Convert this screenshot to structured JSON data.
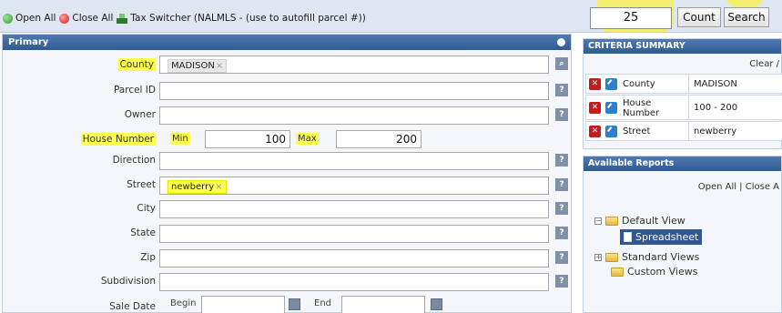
{
  "toolbar": {
    "open_all": "Open All",
    "close_all": "Close All",
    "tax_switcher": "Tax Switcher (NALMLS - (use to autofill parcel #))",
    "count_value": "25",
    "count_button": "Count",
    "search_button": "Search"
  },
  "primary": {
    "header": "Primary",
    "fields": {
      "county": {
        "label": "County",
        "tag": "MADISON",
        "tag_x": "×"
      },
      "parcel_id": {
        "label": "Parcel ID"
      },
      "owner": {
        "label": "Owner"
      },
      "house_number": {
        "label": "House Number",
        "min_label": "Min",
        "min_value": "100",
        "max_label": "Max",
        "max_value": "200"
      },
      "direction": {
        "label": "Direction"
      },
      "street": {
        "label": "Street",
        "tag": "newberry",
        "tag_x": "×"
      },
      "city": {
        "label": "City"
      },
      "state": {
        "label": "State"
      },
      "zip": {
        "label": "Zip"
      },
      "subdivision": {
        "label": "Subdivision"
      },
      "sale_date": {
        "label": "Sale Date",
        "begin_label": "Begin",
        "end_label": "End"
      }
    }
  },
  "criteria": {
    "header": "CRITERIA SUMMARY",
    "clear_link": "Clear /",
    "rows": [
      {
        "key": "County",
        "value": "MADISON"
      },
      {
        "key": "House Number",
        "value": "100 - 200"
      },
      {
        "key": "Street",
        "value": "newberry"
      }
    ]
  },
  "reports": {
    "header": "Available Reports",
    "links": "Open All | Close A",
    "tree": {
      "default_view": "Default View",
      "spreadsheet": "Spreadsheet",
      "standard_views": "Standard Views",
      "custom_views": "Custom Views"
    }
  },
  "colors": {
    "highlight": "#ffff4d",
    "header_blue": "#2f5b94",
    "selected": "#31588f"
  }
}
